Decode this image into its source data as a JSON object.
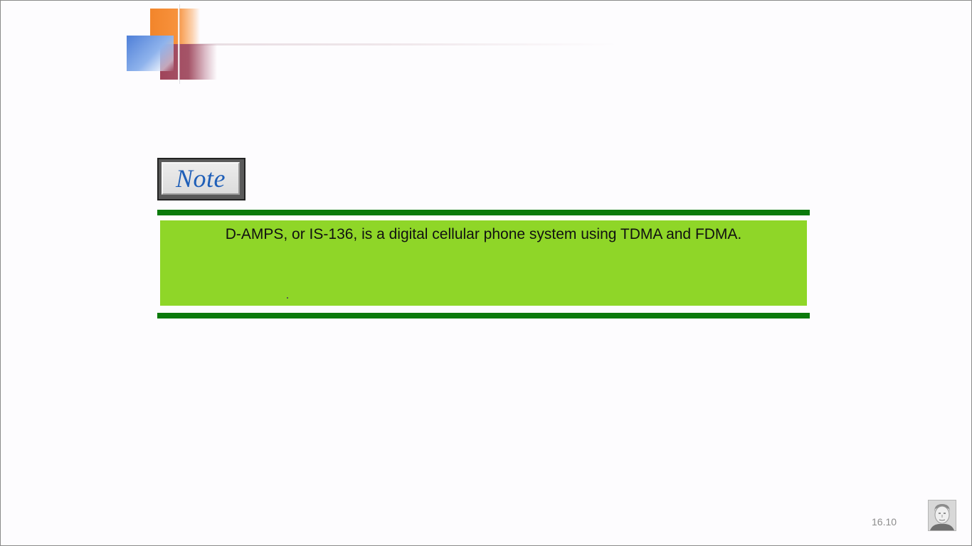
{
  "slide": {
    "note_label": "Note",
    "note_text": "D-AMPS, or IS-136, is a digital cellular phone system using TDMA and FDMA.",
    "page_number": "16.10"
  },
  "colors": {
    "note_box_fill": "#8fd628",
    "note_bar": "#0b7a0b",
    "note_label": "#1f5fb8"
  },
  "icons": {
    "header_decoration": "overlapping-squares-logo",
    "avatar": "presenter-photo"
  }
}
